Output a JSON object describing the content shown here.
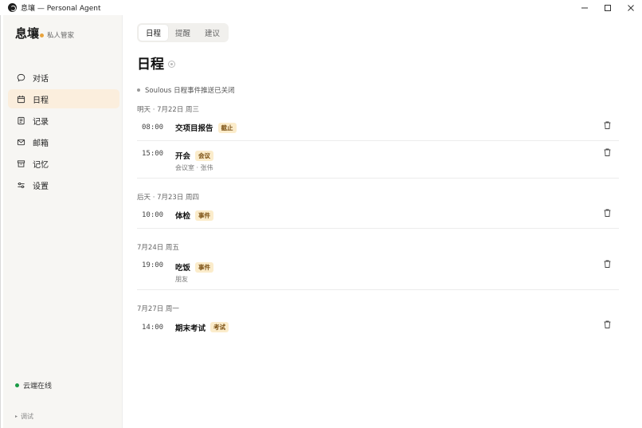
{
  "window": {
    "title": "息壤 — Personal Agent",
    "controls": [
      "minimize",
      "maximize",
      "close"
    ]
  },
  "sidebar": {
    "brand_name": "息壤",
    "brand_sub": "私人管家",
    "items": [
      {
        "label": "对话",
        "icon": "chat-icon",
        "active": false
      },
      {
        "label": "日程",
        "icon": "calendar-icon",
        "active": true
      },
      {
        "label": "记录",
        "icon": "notes-icon",
        "active": false
      },
      {
        "label": "邮箱",
        "icon": "mail-icon",
        "active": false
      },
      {
        "label": "记忆",
        "icon": "archive-icon",
        "active": false
      },
      {
        "label": "设置",
        "icon": "settings-sliders-icon",
        "active": false
      }
    ],
    "cloud_status": "云端在线",
    "debug_label": "调试"
  },
  "tabs": [
    {
      "label": "日程",
      "active": true
    },
    {
      "label": "提醒",
      "active": false
    },
    {
      "label": "建议",
      "active": false
    }
  ],
  "page_title": "日程",
  "notice": "Soulous 日程事件推送已关闭",
  "days": [
    {
      "header": "明天 · 7月22日 周三",
      "events": [
        {
          "time": "08:00",
          "title": "交项目报告",
          "tag": "截止",
          "sub": ""
        },
        {
          "time": "15:00",
          "title": "开会",
          "tag": "会议",
          "sub": "会议室 · 张伟"
        }
      ]
    },
    {
      "header": "后天 · 7月23日 周四",
      "events": [
        {
          "time": "10:00",
          "title": "体检",
          "tag": "事件",
          "sub": ""
        }
      ]
    },
    {
      "header": "7月24日 周五",
      "events": [
        {
          "time": "19:00",
          "title": "吃饭",
          "tag": "事件",
          "sub": "朋友"
        }
      ]
    },
    {
      "header": "7月27日 周一",
      "events": [
        {
          "time": "14:00",
          "title": "期末考试",
          "tag": "考试",
          "sub": ""
        }
      ]
    }
  ],
  "colors": {
    "accent": "#e8a33d",
    "active_nav_bg": "#fbeedd",
    "tag_bg": "#fbeccb",
    "tag_text": "#7a4f12",
    "online": "#1a9b46"
  }
}
